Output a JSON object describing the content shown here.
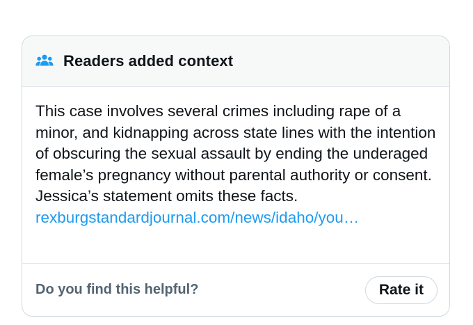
{
  "note": {
    "header_title": "Readers added context",
    "header_icon": "people-icon",
    "body_text": "This case involves several crimes including rape of a minor, and kidnapping across state lines with the intention of obscuring the sexual assault by ending the underaged female’s pregnancy without parental authority or consent. Jessica’s statement omits these facts. ",
    "link_text": "rexburgstandardjournal.com/​news/idaho/you…",
    "footer_question": "Do you find this helpful?",
    "rate_button_label": "Rate it"
  },
  "colors": {
    "text": "#0f1419",
    "muted": "#536471",
    "link": "#1d9bf0",
    "border": "#cfd9de",
    "header_bg": "#f7f9f9"
  }
}
